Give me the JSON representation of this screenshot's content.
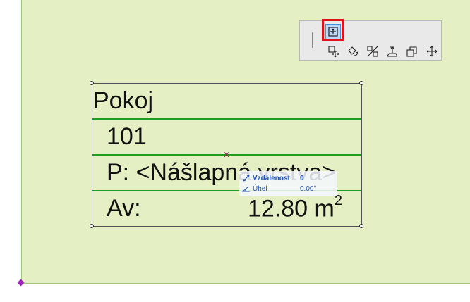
{
  "zone_stamp": {
    "name": "Pokoj",
    "number": "101",
    "floor_line": "P: <Nášlapná vrstva>",
    "area_label": "Av:",
    "area_value": "12.80 m",
    "area_unit_sup": "2"
  },
  "tracker": {
    "distance_label": "Vzdálenost",
    "distance_value": "0",
    "angle_label": "Úhel",
    "angle_value": "0.00°"
  },
  "pet_palette": {
    "top_tool": "move-sub-element-icon",
    "tools": [
      "drag-icon",
      "rotate-icon",
      "mirror-icon",
      "elevate-icon",
      "multiply-icon",
      "move-icon"
    ]
  },
  "colors": {
    "canvas": "#e4f0c4",
    "zone_lines": "#1f9c20",
    "highlight": "#e0121b",
    "tracker_text": "#2255bb"
  }
}
